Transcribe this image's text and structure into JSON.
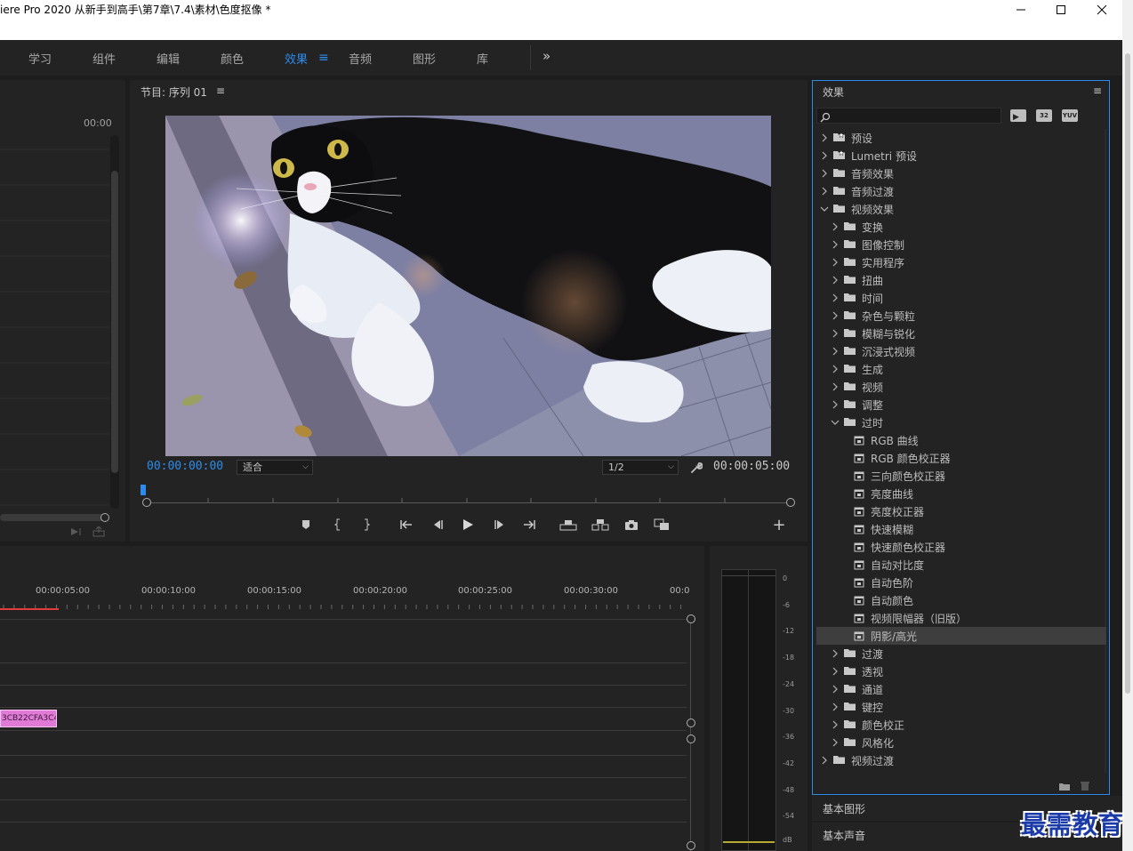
{
  "window": {
    "title": "iere Pro 2020 从新手到高手\\第7章\\7.4\\素材\\色度抠像 *",
    "minimize_icon": "minimize-icon",
    "maximize_icon": "maximize-icon",
    "close_icon": "close-icon"
  },
  "workspaces": {
    "items": [
      {
        "label": "学习",
        "active": false
      },
      {
        "label": "组件",
        "active": false
      },
      {
        "label": "编辑",
        "active": false
      },
      {
        "label": "颜色",
        "active": false
      },
      {
        "label": "效果",
        "active": true
      },
      {
        "label": "音频",
        "active": false
      },
      {
        "label": "图形",
        "active": false
      },
      {
        "label": "库",
        "active": false
      }
    ],
    "active_menu_glyph": "≡",
    "more_glyph": "»"
  },
  "source_panel": {
    "timecode": "00:00"
  },
  "program_monitor": {
    "title": "节目: 序列 01",
    "menu_glyph": "≡",
    "timecode_current": "00:00:00:00",
    "fit_select": "适合",
    "resolution_select": "1/2",
    "timecode_duration": "00:00:05:00",
    "add_glyph": "+"
  },
  "timeline": {
    "time_labels": [
      "00:00:05:00",
      "00:00:10:00",
      "00:00:15:00",
      "00:00:20:00",
      "00:00:25:00",
      "00:00:30:00",
      "00:0"
    ],
    "clip_label": "3CB22CFA3C4"
  },
  "audio_meter": {
    "scale": [
      "0",
      "-6",
      "-12",
      "-18",
      "-24",
      "-30",
      "-36",
      "-42",
      "-48",
      "-54",
      "dB"
    ]
  },
  "effects_panel": {
    "title": "效果",
    "menu_glyph": "≡",
    "search_placeholder": "",
    "badges": [
      "",
      "32",
      "YUV"
    ],
    "tree": [
      {
        "label": "预设",
        "level": 0,
        "type": "preset",
        "expanded": false
      },
      {
        "label": "Lumetri 预设",
        "level": 0,
        "type": "preset",
        "expanded": false
      },
      {
        "label": "音频效果",
        "level": 0,
        "type": "folder",
        "expanded": false
      },
      {
        "label": "音频过渡",
        "level": 0,
        "type": "folder",
        "expanded": false
      },
      {
        "label": "视频效果",
        "level": 0,
        "type": "folder",
        "expanded": true
      },
      {
        "label": "变换",
        "level": 1,
        "type": "folder",
        "expanded": false
      },
      {
        "label": "图像控制",
        "level": 1,
        "type": "folder",
        "expanded": false
      },
      {
        "label": "实用程序",
        "level": 1,
        "type": "folder",
        "expanded": false
      },
      {
        "label": "扭曲",
        "level": 1,
        "type": "folder",
        "expanded": false
      },
      {
        "label": "时间",
        "level": 1,
        "type": "folder",
        "expanded": false
      },
      {
        "label": "杂色与颗粒",
        "level": 1,
        "type": "folder",
        "expanded": false
      },
      {
        "label": "模糊与锐化",
        "level": 1,
        "type": "folder",
        "expanded": false
      },
      {
        "label": "沉浸式视频",
        "level": 1,
        "type": "folder",
        "expanded": false
      },
      {
        "label": "生成",
        "level": 1,
        "type": "folder",
        "expanded": false
      },
      {
        "label": "视频",
        "level": 1,
        "type": "folder",
        "expanded": false
      },
      {
        "label": "调整",
        "level": 1,
        "type": "folder",
        "expanded": false
      },
      {
        "label": "过时",
        "level": 1,
        "type": "folder",
        "expanded": true
      },
      {
        "label": "RGB 曲线",
        "level": 2,
        "type": "effect"
      },
      {
        "label": "RGB 颜色校正器",
        "level": 2,
        "type": "effect"
      },
      {
        "label": "三向颜色校正器",
        "level": 2,
        "type": "effect"
      },
      {
        "label": "亮度曲线",
        "level": 2,
        "type": "effect"
      },
      {
        "label": "亮度校正器",
        "level": 2,
        "type": "effect"
      },
      {
        "label": "快速模糊",
        "level": 2,
        "type": "effect"
      },
      {
        "label": "快速颜色校正器",
        "level": 2,
        "type": "effect"
      },
      {
        "label": "自动对比度",
        "level": 2,
        "type": "effect"
      },
      {
        "label": "自动色阶",
        "level": 2,
        "type": "effect"
      },
      {
        "label": "自动颜色",
        "level": 2,
        "type": "effect"
      },
      {
        "label": "视频限幅器（旧版）",
        "level": 2,
        "type": "effect"
      },
      {
        "label": "阴影/高光",
        "level": 2,
        "type": "effect",
        "selected": true
      },
      {
        "label": "过渡",
        "level": 1,
        "type": "folder",
        "expanded": false
      },
      {
        "label": "透视",
        "level": 1,
        "type": "folder",
        "expanded": false
      },
      {
        "label": "通道",
        "level": 1,
        "type": "folder",
        "expanded": false
      },
      {
        "label": "键控",
        "level": 1,
        "type": "folder",
        "expanded": false
      },
      {
        "label": "颜色校正",
        "level": 1,
        "type": "folder",
        "expanded": false
      },
      {
        "label": "风格化",
        "level": 1,
        "type": "folder",
        "expanded": false
      },
      {
        "label": "视频过渡",
        "level": 0,
        "type": "folder",
        "expanded": false
      }
    ]
  },
  "essential_graphics": {
    "title": "基本图形"
  },
  "essential_sound": {
    "title": "基本声音"
  },
  "watermark": "最需教育",
  "colors": {
    "accent": "#2d8ceb",
    "clip": "#e07ad6",
    "playhead_red": "#e23b3b",
    "selected_row": "#3e3e3e"
  }
}
